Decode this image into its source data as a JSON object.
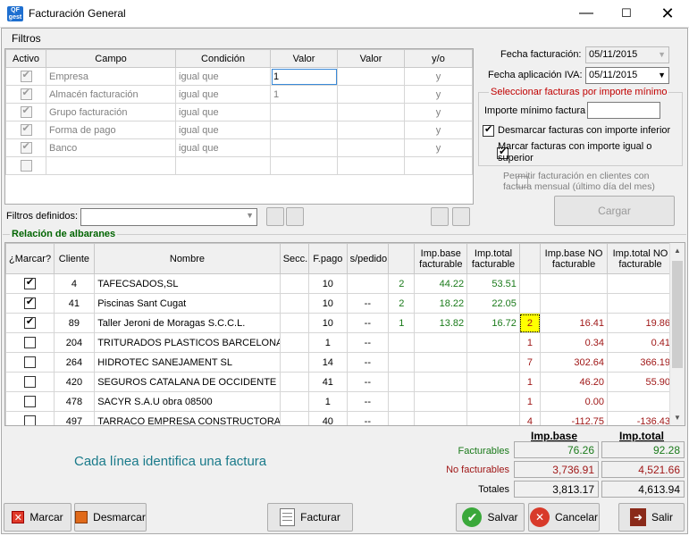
{
  "window": {
    "title": "Facturación General",
    "app_icon_text": "QF gest"
  },
  "filtros": {
    "legend": "Filtros",
    "columns": [
      "Activo",
      "Campo",
      "Condición",
      "Valor",
      "Valor",
      "y/o"
    ],
    "rows": [
      {
        "active": true,
        "campo": "Empresa",
        "condicion": "igual que",
        "valor1": "1",
        "valor2": "",
        "yo": "y"
      },
      {
        "active": true,
        "campo": "Almacén facturación",
        "condicion": "igual que",
        "valor1": "1",
        "valor2": "",
        "yo": "y"
      },
      {
        "active": true,
        "campo": "Grupo facturación",
        "condicion": "igual que",
        "valor1": "",
        "valor2": "",
        "yo": "y"
      },
      {
        "active": true,
        "campo": "Forma de pago",
        "condicion": "igual que",
        "valor1": "",
        "valor2": "",
        "yo": "y"
      },
      {
        "active": true,
        "campo": "Banco",
        "condicion": "igual que",
        "valor1": "",
        "valor2": "",
        "yo": "y"
      },
      {
        "active": false,
        "campo": "",
        "condicion": "",
        "valor1": "",
        "valor2": "",
        "yo": ""
      }
    ],
    "definidos_label": "Filtros definidos:",
    "definidos_value": ""
  },
  "fechas": {
    "facturacion_label": "Fecha facturación:",
    "facturacion_value": "05/11/2015",
    "iva_label": "Fecha aplicación IVA:",
    "iva_value": "05/11/2015"
  },
  "importe_group": {
    "legend": "Seleccionar facturas por importe mínimo",
    "importe_label": "Importe mínimo factura",
    "importe_value": "",
    "desmarcar_label": "Desmarcar facturas con importe inferior",
    "desmarcar_checked": true,
    "marcar_label": "Marcar facturas con importe igual o superior",
    "marcar_checked": true
  },
  "permitir": {
    "label": "Permitir facturación en clientes con factura mensual (último día del mes)",
    "checked": false
  },
  "cargar_label": "Cargar",
  "albaranes": {
    "legend": "Relación de albaranes",
    "columns": [
      "¿Marcar?",
      "Cliente",
      "Nombre",
      "Secc.",
      "F.pago",
      "s/pedido",
      "",
      "Imp.base facturable",
      "Imp.total facturable",
      "",
      "Imp.base NO facturable",
      "Imp.total NO facturable"
    ],
    "rows": [
      {
        "marcar": true,
        "cliente": "4",
        "nombre": "TAFECSADOS,SL",
        "secc": "",
        "fpago": "10",
        "spedido": "",
        "n1": "2",
        "base_f": "44.22",
        "total_f": "53.51",
        "n2": "",
        "base_nf": "",
        "total_nf": ""
      },
      {
        "marcar": true,
        "cliente": "41",
        "nombre": "Piscinas Sant Cugat",
        "secc": "",
        "fpago": "10",
        "spedido": "--",
        "n1": "2",
        "base_f": "18.22",
        "total_f": "22.05",
        "n2": "",
        "base_nf": "",
        "total_nf": ""
      },
      {
        "marcar": true,
        "cliente": "89",
        "nombre": "Taller Jeroni de Moragas S.C.C.L.",
        "secc": "",
        "fpago": "10",
        "spedido": "--",
        "n1": "1",
        "base_f": "13.82",
        "total_f": "16.72",
        "n2": "2",
        "base_nf": "16.41",
        "total_nf": "19.86"
      },
      {
        "marcar": false,
        "cliente": "204",
        "nombre": "TRITURADOS PLASTICOS BARCELONA",
        "secc": "",
        "fpago": "1",
        "spedido": "--",
        "n1": "",
        "base_f": "",
        "total_f": "",
        "n2": "1",
        "base_nf": "0.34",
        "total_nf": "0.41"
      },
      {
        "marcar": false,
        "cliente": "264",
        "nombre": "HIDROTEC SANEJAMENT SL",
        "secc": "",
        "fpago": "14",
        "spedido": "--",
        "n1": "",
        "base_f": "",
        "total_f": "",
        "n2": "7",
        "base_nf": "302.64",
        "total_nf": "366.19"
      },
      {
        "marcar": false,
        "cliente": "420",
        "nombre": "SEGUROS CATALANA DE OCCIDENTE SA",
        "secc": "",
        "fpago": "41",
        "spedido": "--",
        "n1": "",
        "base_f": "",
        "total_f": "",
        "n2": "1",
        "base_nf": "46.20",
        "total_nf": "55.90"
      },
      {
        "marcar": false,
        "cliente": "478",
        "nombre": "SACYR S.A.U  obra 08500",
        "secc": "",
        "fpago": "1",
        "spedido": "--",
        "n1": "",
        "base_f": "",
        "total_f": "",
        "n2": "1",
        "base_nf": "0.00",
        "total_nf": ""
      },
      {
        "marcar": false,
        "cliente": "497",
        "nombre": "TARRACO EMPRESA CONSTRUCTORA",
        "secc": "",
        "fpago": "40",
        "spedido": "--",
        "n1": "",
        "base_f": "",
        "total_f": "",
        "n2": "4",
        "base_nf": "-112.75",
        "total_nf": "-136.43"
      }
    ]
  },
  "info_text": "Cada línea identifica una factura",
  "totales": {
    "header_base": "Imp.base",
    "header_total": "Imp.total",
    "facturables_label": "Facturables",
    "facturables_base": "76.26",
    "facturables_total": "92.28",
    "no_facturables_label": "No facturables",
    "no_facturables_base": "3,736.91",
    "no_facturables_total": "4,521.66",
    "totales_label": "Totales",
    "totales_base": "3,813.17",
    "totales_total": "4,613.94"
  },
  "buttons": {
    "marcar": "Marcar",
    "desmarcar": "Desmarcar",
    "facturar": "Facturar",
    "salvar": "Salvar",
    "cancelar": "Cancelar",
    "salir": "Salir"
  },
  "colors": {
    "green": "#1a7a1a",
    "red": "#a01818",
    "legend_green": "#006400",
    "legend_red": "#c00000",
    "info_teal": "#1a7a8a"
  }
}
